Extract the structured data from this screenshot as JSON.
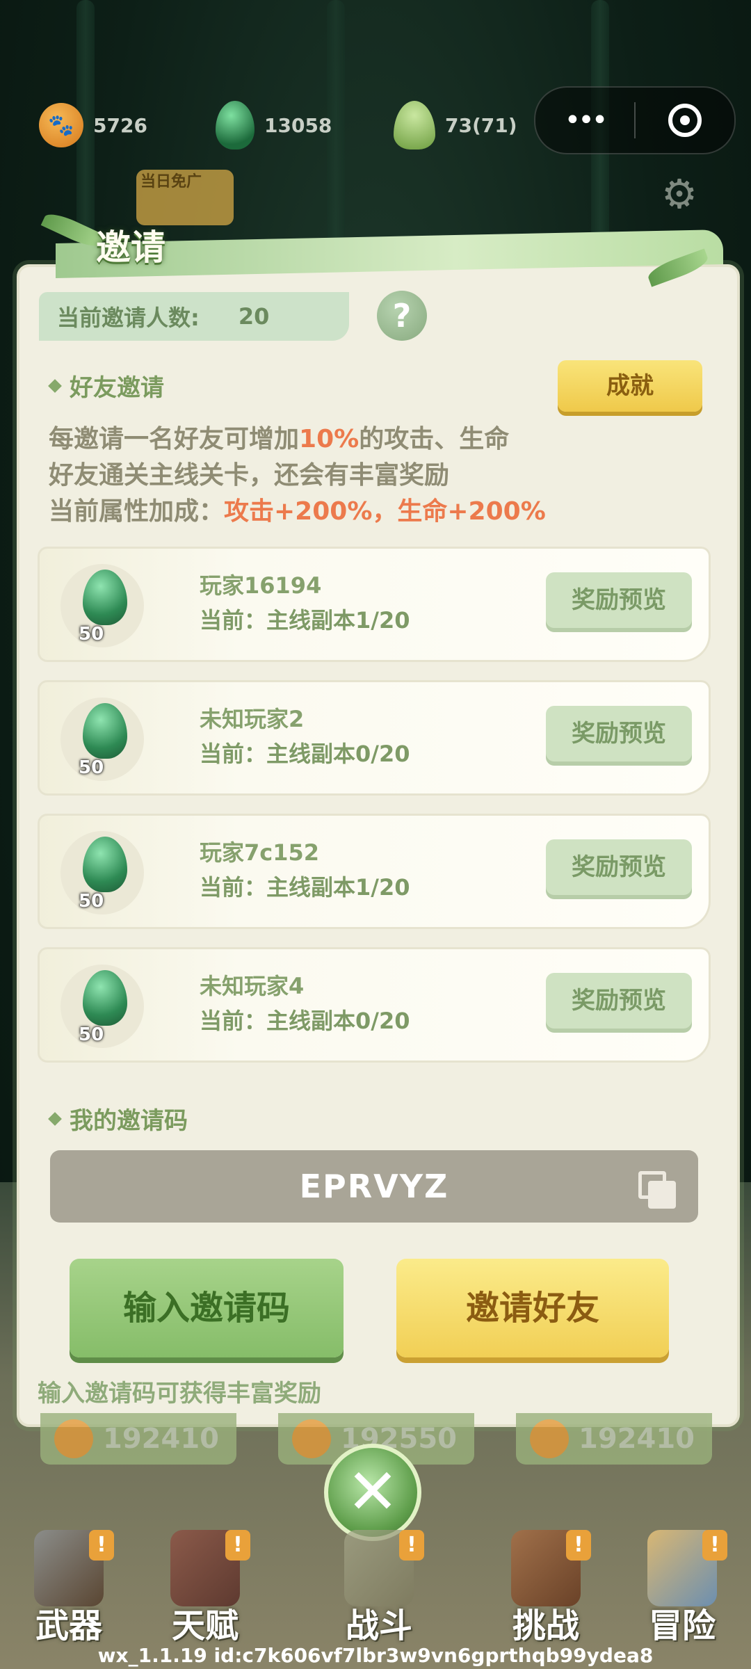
{
  "resources": {
    "coins": "5726",
    "gems": "13058",
    "buds": "73(71)",
    "coin_glyph": "🐾"
  },
  "capsule": {
    "more": "•••"
  },
  "ad_badge": {
    "text": "当日免广"
  },
  "panel": {
    "title": "邀请",
    "count_label": "当前邀请人数:",
    "count_value": "20",
    "help": "?",
    "friend_section": "好友邀请",
    "achievement_button": "成就",
    "desc_line1_a": "每邀请一名好友可增加",
    "desc_line1_hl": "10%",
    "desc_line1_b": "的攻击、生命",
    "desc_line2": "好友通关主线关卡，还会有丰富奖励",
    "desc_line3_a": "当前属性加成：",
    "desc_line3_hl": "攻击+200%，生命+200%",
    "friends": [
      {
        "name": "玩家16194",
        "progress": "当前：主线副本1/20",
        "reward_qty": "50",
        "preview": "奖励预览"
      },
      {
        "name": "未知玩家2",
        "progress": "当前：主线副本0/20",
        "reward_qty": "50",
        "preview": "奖励预览"
      },
      {
        "name": "玩家7c152",
        "progress": "当前：主线副本1/20",
        "reward_qty": "50",
        "preview": "奖励预览"
      },
      {
        "name": "未知玩家4",
        "progress": "当前：主线副本0/20",
        "reward_qty": "50",
        "preview": "奖励预览"
      }
    ],
    "code_section": "我的邀请码",
    "invite_code": "EPRVYZ",
    "enter_code_button": "输入邀请码",
    "invite_button": "邀请好友",
    "hint": "输入邀请码可获得丰富奖励"
  },
  "strips": [
    "192410",
    "192550",
    "192410"
  ],
  "close_glyph": "✕",
  "nav": [
    {
      "label": "武器",
      "badge": "!"
    },
    {
      "label": "天赋",
      "badge": "!"
    },
    {
      "label": "战斗",
      "badge": "!"
    },
    {
      "label": "挑战",
      "badge": "!"
    },
    {
      "label": "冒险",
      "badge": "!"
    }
  ],
  "footer": "wx_1.1.19 id:c7k606vf7lbr3w9vn6gprthqb99ydea8",
  "colors": {
    "accent_green": "#86bd69",
    "accent_yellow": "#f1cf55",
    "highlight": "#ec7a4c"
  }
}
